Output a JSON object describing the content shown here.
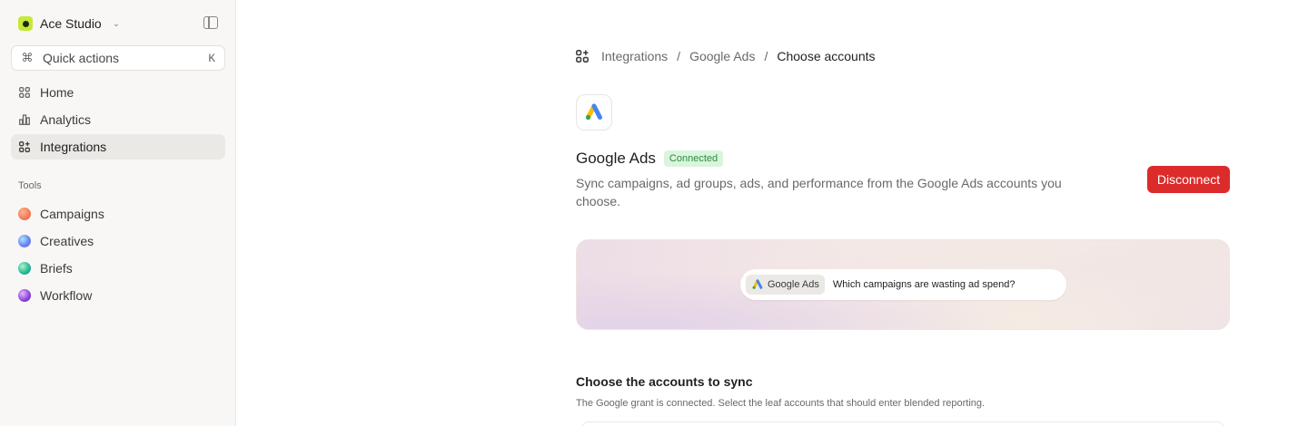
{
  "sidebar": {
    "workspace": {
      "name": "Ace Studio",
      "logo_color": "#c6e83a"
    },
    "quick_actions": {
      "label": "Quick actions",
      "shortcut": "K"
    },
    "nav": [
      {
        "label": "Home",
        "icon": "grid-icon"
      },
      {
        "label": "Analytics",
        "icon": "bar-chart-icon"
      },
      {
        "label": "Integrations",
        "icon": "integrations-icon",
        "active": true
      }
    ],
    "tools_label": "Tools",
    "tools": [
      {
        "label": "Campaigns",
        "color": "#f0764a"
      },
      {
        "label": "Creatives",
        "color": "#6aa7f2"
      },
      {
        "label": "Briefs",
        "color": "#3fc79a"
      },
      {
        "label": "Workflow",
        "color": "#9b5de5"
      }
    ]
  },
  "breadcrumb": [
    "Integrations",
    "Google Ads",
    "Choose accounts"
  ],
  "integration": {
    "name": "Google Ads",
    "status": "Connected",
    "description": "Sync campaigns, ad groups, ads, and performance from the Google Ads accounts you choose.",
    "disconnect_label": "Disconnect"
  },
  "hero": {
    "chip_label": "Google Ads",
    "prompt": "Which campaigns are wasting ad spend?"
  },
  "accounts_section": {
    "title": "Choose the accounts to sync",
    "description": "The Google grant is connected. Select the leaf accounts that should enter blended reporting."
  },
  "colors": {
    "accent_danger": "#dc2b2b",
    "badge_green": "#2e8b3e",
    "badge_bg": "#d9f5dd"
  }
}
